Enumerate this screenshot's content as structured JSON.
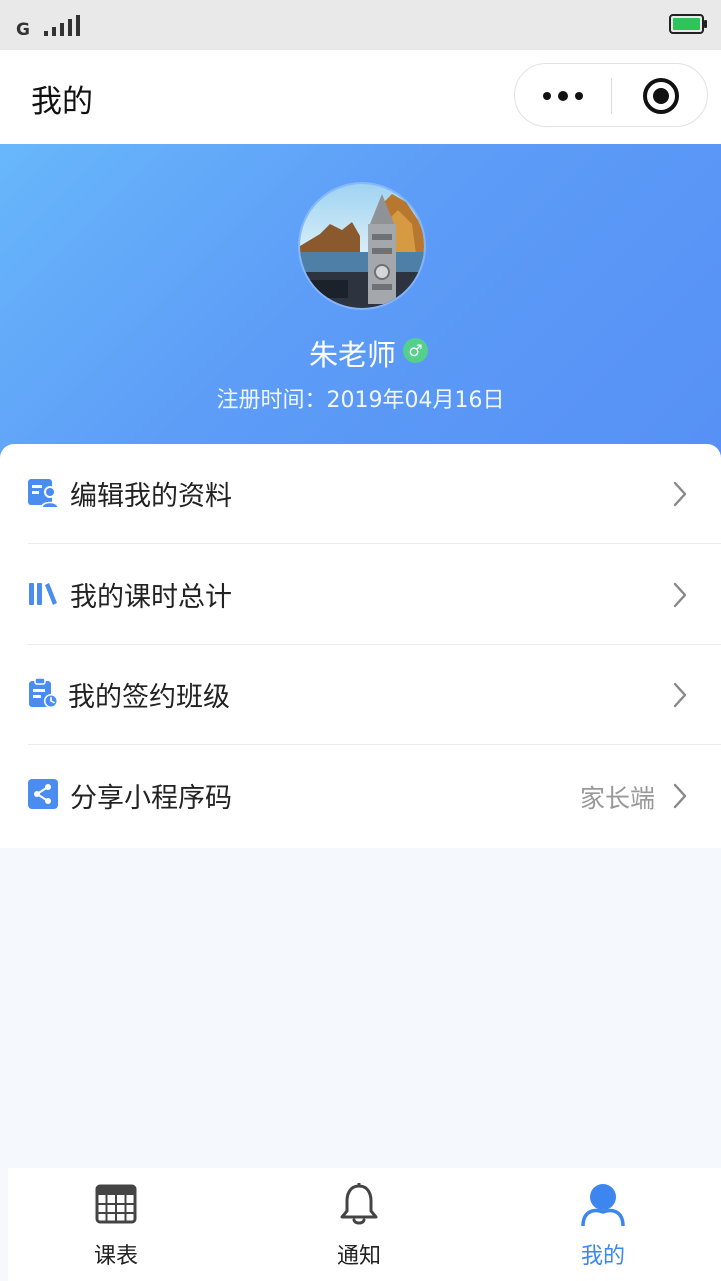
{
  "status_bar": {
    "carrier": "G"
  },
  "header": {
    "title": "我的"
  },
  "profile": {
    "name": "朱老师",
    "gender_symbol": "♂",
    "register_label": "注册时间：",
    "register_date": "2019年04月16日"
  },
  "menu": {
    "items": [
      {
        "label": "编辑我的资料",
        "extra": "",
        "icon": "profile-edit-icon"
      },
      {
        "label": "我的课时总计",
        "extra": "",
        "icon": "books-icon"
      },
      {
        "label": "我的签约班级",
        "extra": "",
        "icon": "clipboard-clock-icon"
      },
      {
        "label": "分享小程序码",
        "extra": "家长端",
        "icon": "share-icon"
      }
    ]
  },
  "tabbar": {
    "tabs": [
      {
        "label": "课表",
        "icon": "calendar-grid-icon",
        "active": false
      },
      {
        "label": "通知",
        "icon": "bell-icon",
        "active": false
      },
      {
        "label": "我的",
        "icon": "person-icon",
        "active": true
      }
    ]
  },
  "colors": {
    "accent": "#3d86f0",
    "banner_start": "#68b7fb",
    "banner_end": "#5690f5",
    "gender_badge": "#53d18c",
    "icon_blue": "#4a8cf0"
  }
}
